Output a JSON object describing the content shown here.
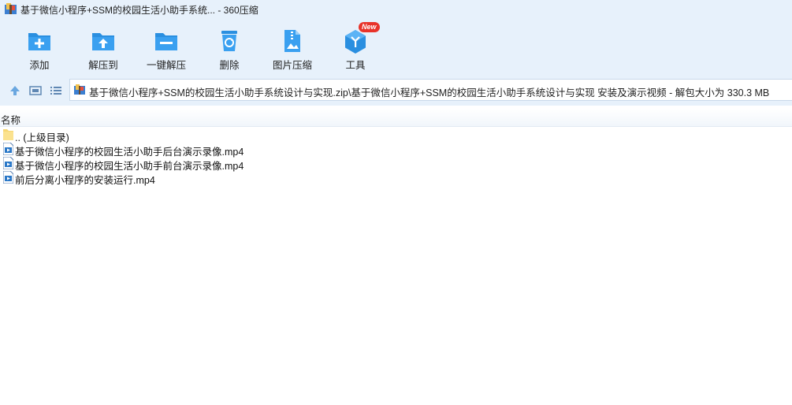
{
  "window": {
    "title": "基于微信小程序+SSM的校园生活小助手系统... - 360压缩"
  },
  "toolbar": {
    "items": [
      {
        "label": "添加",
        "icon": "add-folder-icon"
      },
      {
        "label": "解压到",
        "icon": "extract-to-icon"
      },
      {
        "label": "一键解压",
        "icon": "one-click-extract-icon"
      },
      {
        "label": "删除",
        "icon": "recycle-bin-icon"
      },
      {
        "label": "图片压缩",
        "icon": "image-compress-icon"
      },
      {
        "label": "工具",
        "icon": "tools-icon",
        "badge": "New"
      }
    ]
  },
  "addressbar": {
    "path": "基于微信小程序+SSM的校园生活小助手系统设计与实现.zip\\基于微信小程序+SSM的校园生活小助手系统设计与实现 安装及演示视频 - 解包大小为 330.3 MB"
  },
  "list": {
    "column_name": "名称",
    "items": [
      {
        "name": ".. (上级目录)",
        "type": "folder"
      },
      {
        "name": "基于微信小程序的校园生活小助手后台演示录像.mp4",
        "type": "video"
      },
      {
        "name": "基于微信小程序的校园生活小助手前台演示录像.mp4",
        "type": "video"
      },
      {
        "name": "前后分离小程序的安装运行.mp4",
        "type": "video"
      }
    ]
  },
  "colors": {
    "chrome_bg": "#e7f1fb",
    "icon_blue": "#2a8fe0",
    "badge_red": "#e8332a",
    "folder_yellow": "#f7d774"
  }
}
